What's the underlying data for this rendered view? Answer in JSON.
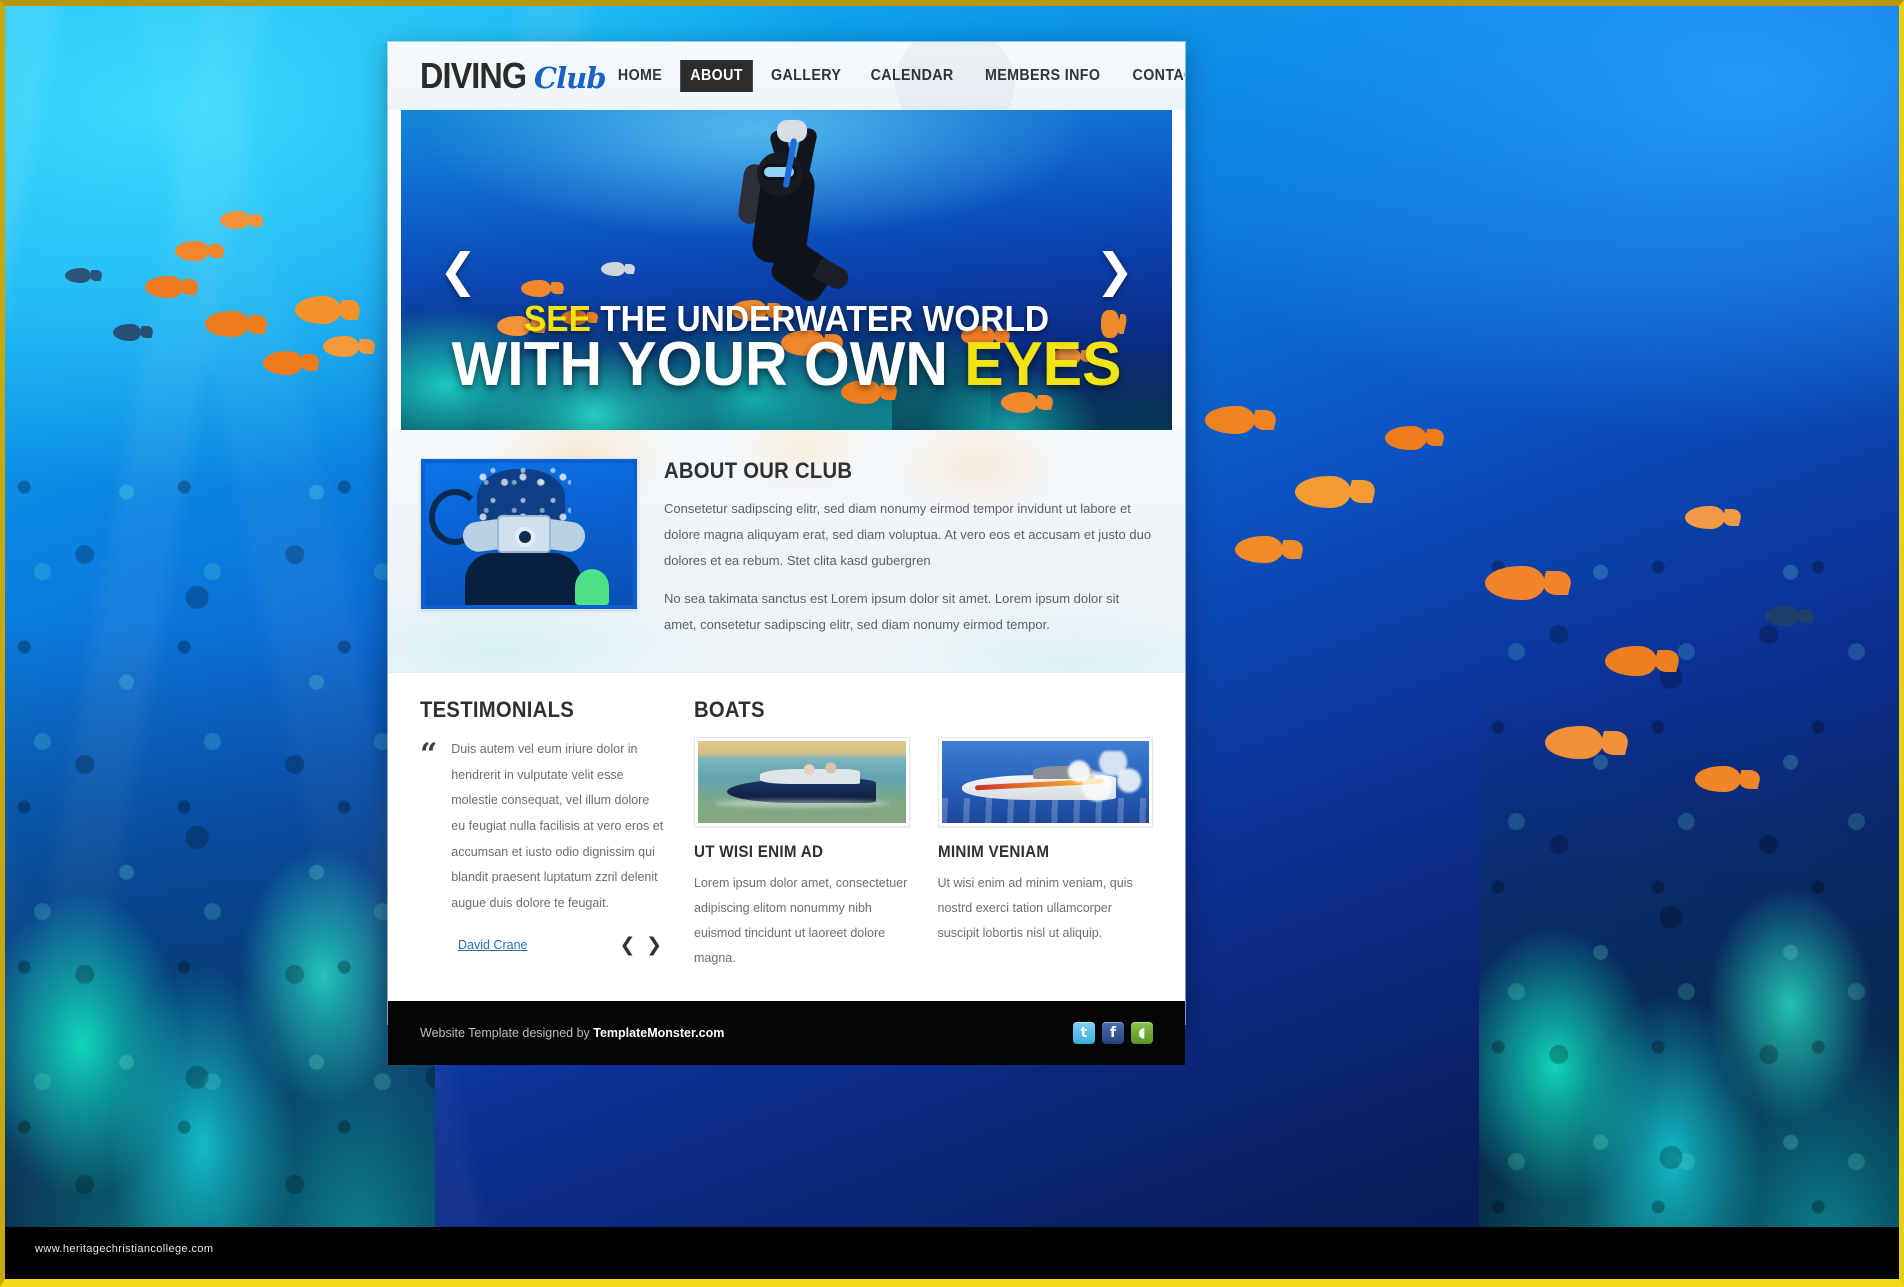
{
  "site": {
    "logo_main": "DIVING",
    "logo_sub": "Club"
  },
  "nav": {
    "items": [
      {
        "label": "HOME",
        "active": false
      },
      {
        "label": "ABOUT",
        "active": true
      },
      {
        "label": "GALLERY",
        "active": false
      },
      {
        "label": "CALENDAR",
        "active": false
      },
      {
        "label": "MEMBERS INFO",
        "active": false
      },
      {
        "label": "CONTACTS",
        "active": false
      }
    ]
  },
  "hero": {
    "line1_highlight": "SEE",
    "line1_rest": " THE UNDERWATER WORLD",
    "line2_rest": "WITH YOUR OWN ",
    "line2_highlight": "EYES",
    "prev_arrow": "❮",
    "next_arrow": "❯",
    "highlight_color": "#f2e413"
  },
  "about": {
    "title": "ABOUT OUR CLUB",
    "paragraph1": "Consetetur sadipscing elitr, sed diam nonumy eirmod tempor invidunt ut labore et dolore magna aliquyam erat, sed diam voluptua. At vero eos et accusam et justo duo dolores et ea rebum. Stet clita kasd gubergren",
    "paragraph2": "No sea takimata sanctus est Lorem ipsum dolor sit amet. Lorem ipsum dolor sit amet, consetetur sadipscing elitr, sed diam nonumy eirmod tempor."
  },
  "testimonials": {
    "title": "TESTIMONIALS",
    "quote_mark": "“",
    "quote": "Duis autem vel eum iriure dolor in hendrerit in vulputate velit esse molestie consequat, vel illum dolore eu feugiat nulla facilisis at vero eros et accumsan et iusto odio dignissim qui blandit praesent luptatum zzril delenit augue duis dolore te feugait.",
    "author": "David Crane",
    "nav": "❮ ❯",
    "author_color": "#2d6fb5"
  },
  "boats": {
    "title": "BOATS",
    "items": [
      {
        "title": "UT WISI ENIM AD",
        "text": "Lorem ipsum dolor amet, consectetuer adipiscing elitom nonummy nibh euismod tincidunt ut laoreet dolore magna."
      },
      {
        "title": "MINIM VENIAM",
        "text": "Ut wisi enim ad minim veniam, quis nostrd exerci tation ullamcorper suscipit lobortis nisl ut aliquip."
      }
    ]
  },
  "footer": {
    "credit_prefix": "Website Template designed by ",
    "credit_brand": "TemplateMonster.com",
    "social": [
      {
        "name": "twitter",
        "glyph": "t"
      },
      {
        "name": "facebook",
        "glyph": "f"
      },
      {
        "name": "message",
        "glyph": "◖"
      }
    ]
  },
  "watermark": "www.heritagechristiancollege.com"
}
